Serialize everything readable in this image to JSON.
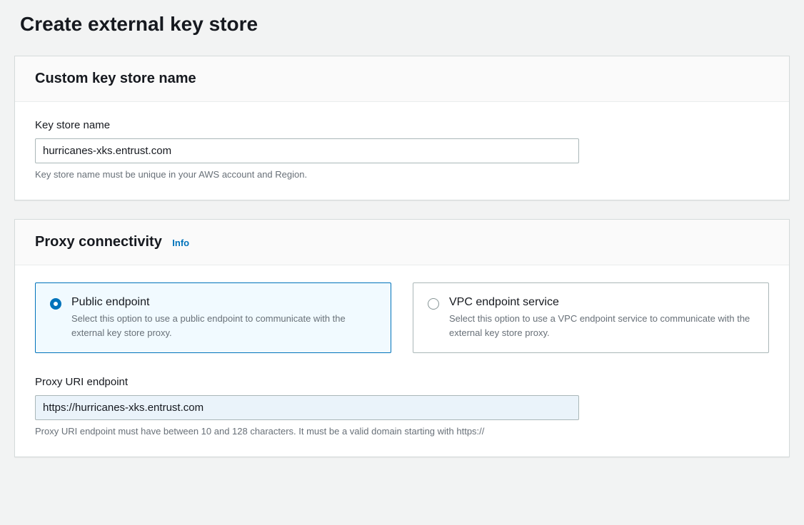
{
  "page": {
    "title": "Create external key store"
  },
  "customKeyStore": {
    "panelTitle": "Custom key store name",
    "fieldLabel": "Key store name",
    "fieldValue": "hurricanes-xks.entrust.com",
    "helpText": "Key store name must be unique in your AWS account and Region."
  },
  "proxyConnectivity": {
    "panelTitle": "Proxy connectivity",
    "infoLabel": "Info",
    "options": {
      "public": {
        "title": "Public endpoint",
        "desc": "Select this option to use a public endpoint to communicate with the external key store proxy.",
        "selected": true
      },
      "vpc": {
        "title": "VPC endpoint service",
        "desc": "Select this option to use a VPC endpoint service to communicate with the external key store proxy.",
        "selected": false
      }
    },
    "proxyUri": {
      "label": "Proxy URI endpoint",
      "value": "https://hurricanes-xks.entrust.com",
      "helpText": "Proxy URI endpoint must have between 10 and 128 characters. It must be a valid domain starting with https://"
    }
  }
}
